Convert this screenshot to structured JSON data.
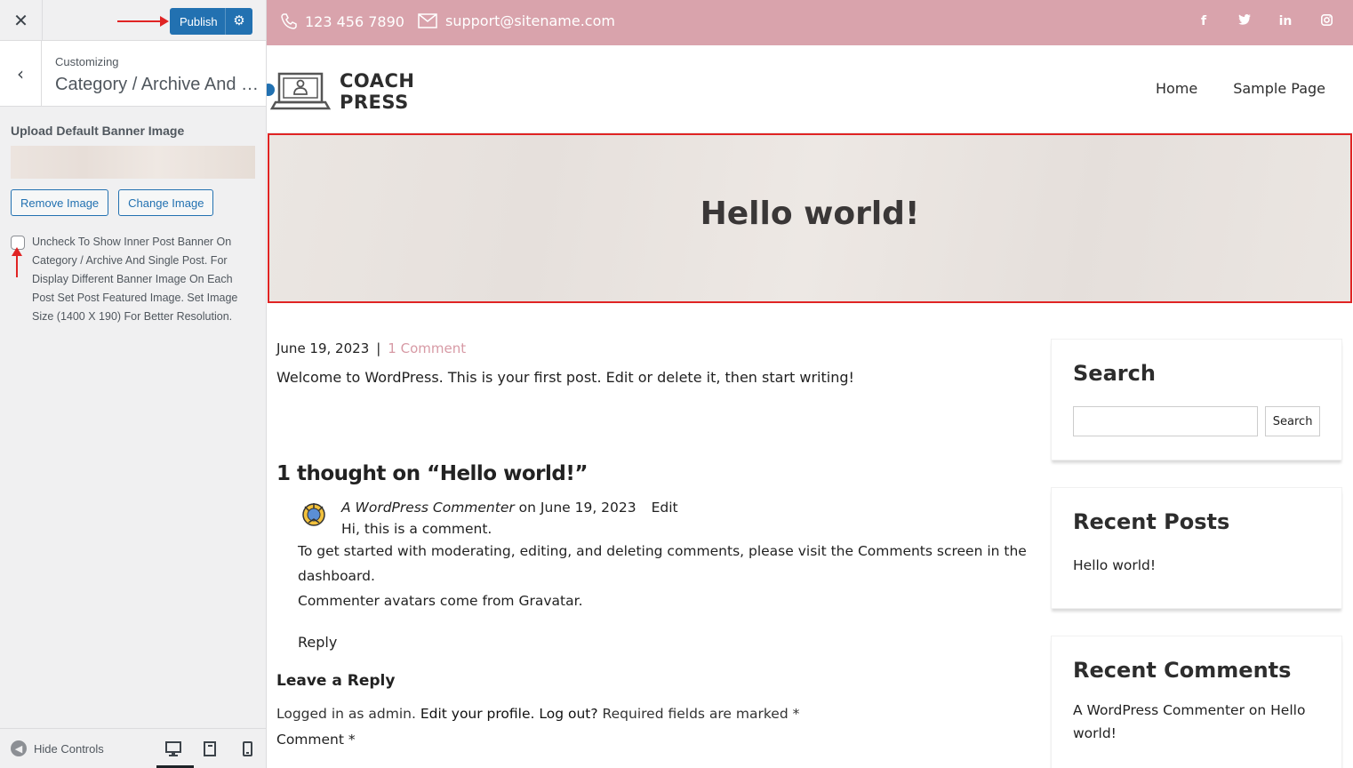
{
  "customizer": {
    "close": "✕",
    "publish": "Publish",
    "back": "‹",
    "crumb": "Customizing",
    "section_title": "Category / Archive And Single Post",
    "upload_label": "Upload Default Banner Image",
    "remove_image": "Remove Image",
    "change_image": "Change Image",
    "checkbox_text": "Uncheck To Show Inner Post Banner On Category / Archive And Single Post. For Display Different Banner Image On Each Post Set Post Featured Image. Set Image Size (1400 X 190) For Better Resolution.",
    "hide_controls": "Hide Controls"
  },
  "topbar": {
    "phone": "123 456 7890",
    "email": "support@sitename.com",
    "social": [
      "f",
      "t",
      "in",
      "ig"
    ]
  },
  "header": {
    "logo_line1": "COACH",
    "logo_line2": "PRESS",
    "nav": [
      "Home",
      "Sample Page"
    ]
  },
  "banner": {
    "title": "Hello world!"
  },
  "post": {
    "date": "June 19, 2023",
    "separator": "|",
    "comment_count": "1 Comment",
    "excerpt": "Welcome to WordPress. This is your first post. Edit or delete it, then start writing!"
  },
  "comments": {
    "title": "1 thought on “Hello world!”",
    "author": "A WordPress Commenter",
    "on": "on",
    "date": "June 19, 2023",
    "edit": "Edit",
    "line1": "Hi, this is a comment.",
    "line2": "To get started with moderating, editing, and deleting comments, please visit the Comments screen in the dashboard.",
    "line3_pre": "Commenter avatars come from",
    "line3_link": "Gravatar",
    "line3_post": ".",
    "reply": "Reply"
  },
  "reply_form": {
    "title": "Leave a Reply",
    "logged_pre": "Logged in as admin.",
    "edit_profile": "Edit your profile.",
    "logout": "Log out?",
    "required": "Required fields are marked *",
    "comment_label": "Comment *"
  },
  "sidebar": {
    "search_title": "Search",
    "search_button": "Search",
    "recent_posts_title": "Recent Posts",
    "recent_post": "Hello world!",
    "recent_comments_title": "Recent Comments",
    "rc_author": "A WordPress Commenter",
    "rc_on": "on",
    "rc_post": "Hello world!"
  },
  "colors": {
    "topbar": "#d9a3ac",
    "accent_link": "#d79aa5",
    "publish": "#2271b1",
    "annotation": "#e02424"
  }
}
